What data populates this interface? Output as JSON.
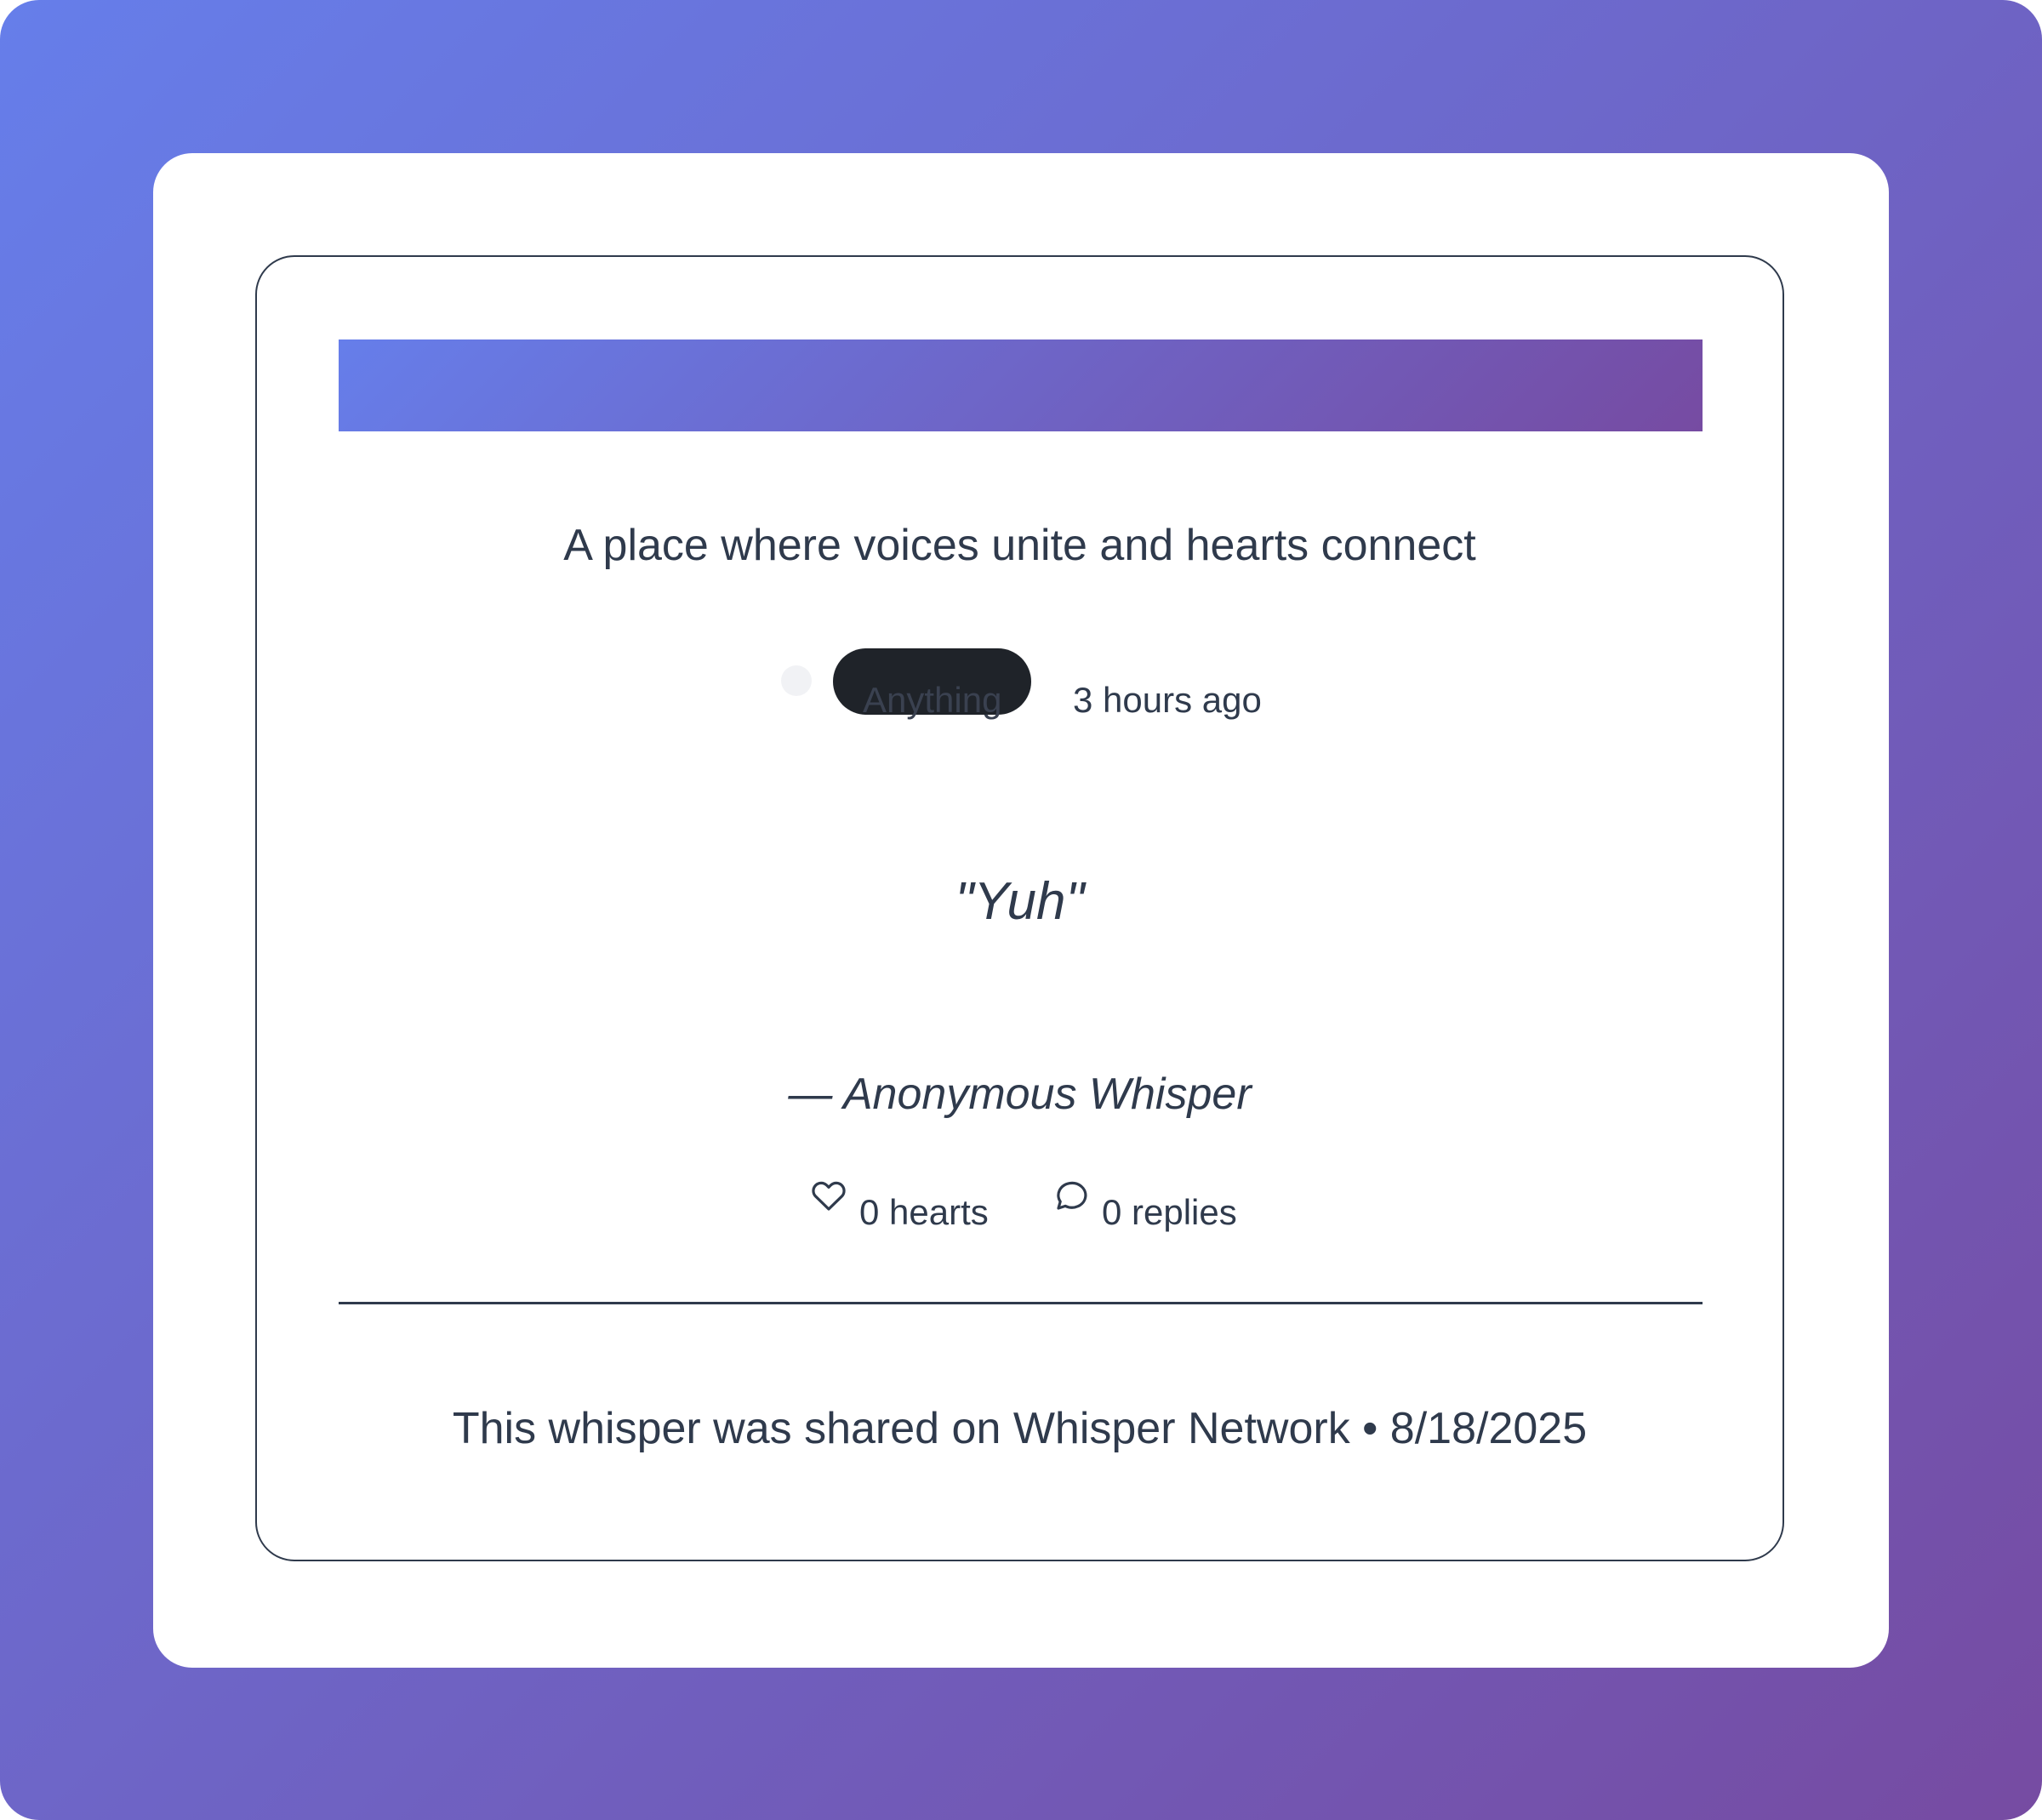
{
  "tagline": "A place where voices unite and hearts connect",
  "meta": {
    "category": "Anything",
    "time_ago": "3 hours ago"
  },
  "whisper": {
    "quote": "\"Yuh\"",
    "attribution": "— Anonymous Whisper"
  },
  "stats": {
    "hearts_label": "0 hearts",
    "replies_label": "0 replies",
    "hearts_icon": "heart-icon",
    "replies_icon": "speech-bubble-icon"
  },
  "footer": {
    "text": "This whisper was shared on Whisper Network • 8/18/2025"
  },
  "colors": {
    "gradient_start": "#667eea",
    "gradient_end": "#764ba2",
    "text": "#2f3a4c",
    "pill": "#1f2329"
  }
}
